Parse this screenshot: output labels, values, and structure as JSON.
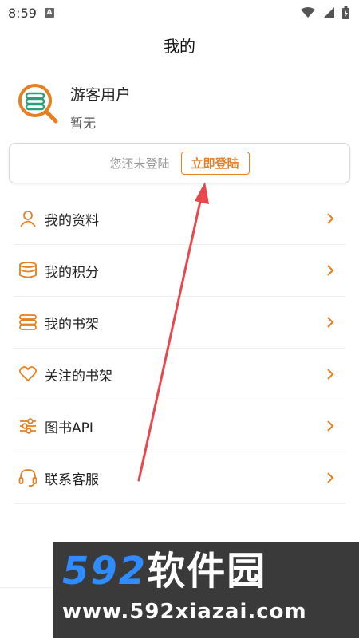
{
  "status": {
    "time": "8:59",
    "app_icon_letter": "A",
    "icons": [
      "wifi-icon",
      "signal-icon",
      "battery-icon"
    ]
  },
  "header": {
    "title": "我的"
  },
  "profile": {
    "name": "游客用户",
    "subtitle": "暂无"
  },
  "login": {
    "hint": "您还未登陆",
    "button": "立即登陆"
  },
  "menu": [
    {
      "label": "我的资料",
      "icon": "user-icon"
    },
    {
      "label": "我的积分",
      "icon": "coins-icon"
    },
    {
      "label": "我的书架",
      "icon": "books-icon"
    },
    {
      "label": "关注的书架",
      "icon": "heart-icon"
    },
    {
      "label": "图书API",
      "icon": "sliders-icon"
    },
    {
      "label": "联系客服",
      "icon": "headset-icon"
    }
  ],
  "watermark": {
    "brand_num": "592",
    "brand_text": "软件园",
    "url": "www.592xiazai.com"
  },
  "colors": {
    "accent": "#e67e22",
    "avatar_green": "#2e9e7a",
    "arrow": "#e8474c"
  }
}
